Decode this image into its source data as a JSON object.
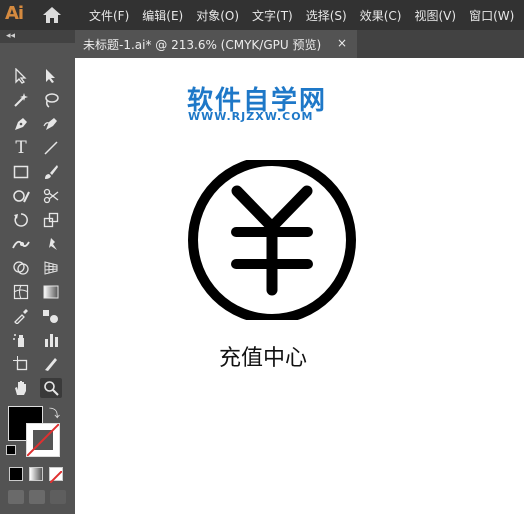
{
  "app": {
    "logo": "Ai"
  },
  "menu": [
    "文件(F)",
    "编辑(E)",
    "对象(O)",
    "文字(T)",
    "选择(S)",
    "效果(C)",
    "视图(V)",
    "窗口(W)"
  ],
  "document": {
    "tab_title": "未标题-1.ai* @ 213.6% (CMYK/GPU 预览)",
    "close_glyph": "×"
  },
  "canvas": {
    "brand": "软件自学网",
    "brand_url": "WWW.RJZXW.COM",
    "caption": "充值中心",
    "icon_name": "yen-coin-icon"
  },
  "toolbar": {
    "collapse_glyph": "◂◂",
    "tools": [
      "selection-tool",
      "direct-selection-tool",
      "magic-wand-tool",
      "lasso-tool",
      "pen-tool",
      "curvature-tool",
      "type-tool",
      "line-segment-tool",
      "rectangle-tool",
      "paintbrush-tool",
      "shaper-tool",
      "scissors-tool",
      "rotate-tool",
      "scale-tool",
      "width-tool",
      "puppet-warp-tool",
      "shape-builder-tool",
      "perspective-grid-tool",
      "mesh-tool",
      "gradient-tool",
      "eyedropper-tool",
      "blend-tool",
      "symbol-sprayer-tool",
      "column-graph-tool",
      "artboard-tool",
      "slice-tool",
      "hand-tool",
      "zoom-tool"
    ],
    "selected_tool": "zoom-tool"
  },
  "colors": {
    "menubar": "#323232",
    "panel": "#535353",
    "brand": "#1e78c8",
    "logo": "#d58a3f"
  }
}
